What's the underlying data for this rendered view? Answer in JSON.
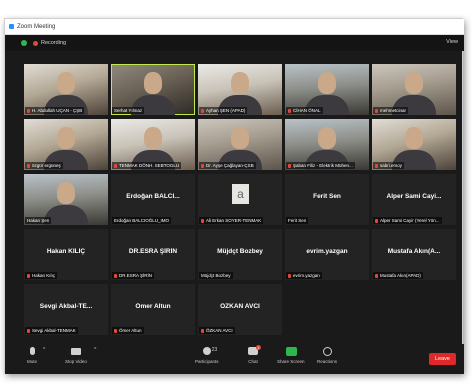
{
  "window": {
    "title": "Zoom Meeting"
  },
  "topbar": {
    "recording_label": "Recording",
    "view_label": "View"
  },
  "tiles": [
    {
      "name": "H. Abdullah UÇAN - ÇŞB",
      "type": "video",
      "variant": "v2",
      "muted": true
    },
    {
      "name": "Serhat Yılmaz",
      "type": "video",
      "variant": "v3",
      "muted": false,
      "active": true
    },
    {
      "name": "Ayhan ŞEN (APAD)",
      "type": "video",
      "variant": "v4",
      "muted": true
    },
    {
      "name": "CİHAN ÖNAL",
      "type": "video",
      "variant": "v5",
      "muted": true
    },
    {
      "name": "mehmetcinar",
      "type": "video",
      "variant": "v1",
      "muted": true
    },
    {
      "name": "özgür ergüneş",
      "type": "video",
      "variant": "v2",
      "muted": true
    },
    {
      "name": "TENMAK DÖNH. SEBTOGLU",
      "type": "video",
      "variant": "v4",
      "muted": true
    },
    {
      "name": "Dr. Ayşe Çağlayan-ÇSB",
      "type": "video",
      "variant": "v1",
      "muted": true
    },
    {
      "name": "Şaban Filiz - Elektrik Mühen...",
      "type": "video",
      "variant": "v5",
      "muted": true
    },
    {
      "name": "sabri.ersoy",
      "type": "video",
      "variant": "v2",
      "muted": true
    },
    {
      "name": "Hakan Şen",
      "type": "video",
      "variant": "v5",
      "muted": false
    },
    {
      "name": "Erdoğan BALCIOĞLU_IMO",
      "label": "Erdoğan BALCI...",
      "type": "name",
      "muted": false
    },
    {
      "name": "Ali Erkan SOYER-TENMAK",
      "label": "a",
      "type": "avatar",
      "muted": true
    },
    {
      "name": "Ferit Sen",
      "label": "Ferit Sen",
      "type": "name",
      "muted": false
    },
    {
      "name": "Alper Sami Cayir (Yerel Yön...",
      "label": "Alper Sami Cayi...",
      "type": "name",
      "muted": true
    },
    {
      "name": "Hakan Kılıç",
      "label": "Hakan KILIÇ",
      "type": "name",
      "muted": true
    },
    {
      "name": "DR.ESRA ŞİRİN",
      "label": "DR.ESRA ŞİRİN",
      "type": "name",
      "muted": true
    },
    {
      "name": "Müjdçt Bozbey",
      "label": "Müjdçt Bozbey",
      "type": "name",
      "muted": false
    },
    {
      "name": "evrim.yazgan",
      "label": "evrim.yazgan",
      "type": "name",
      "muted": true
    },
    {
      "name": "Mustafa Akın(APAD)",
      "label": "Mustafa Akın(A...",
      "type": "name",
      "muted": true
    },
    {
      "name": "Sevgi Akbal-TENMAK",
      "label": "Sevgi Akbal-TE...",
      "type": "name",
      "muted": true
    },
    {
      "name": "Ömer Altun",
      "label": "Ömer Altun",
      "type": "name",
      "muted": true
    },
    {
      "name": "ÖZKAN AVCI",
      "label": "ÖZKAN AVCI",
      "type": "name",
      "muted": true
    }
  ],
  "toolbar": {
    "mute_label": "Mute",
    "video_label": "Stop Video",
    "participants_label": "Participants",
    "participants_count": "23",
    "chat_label": "Chat",
    "chat_badge": "1",
    "share_label": "Share Screen",
    "reactions_label": "Reactions",
    "leave_label": "Leave"
  },
  "colors": {
    "active_speaker": "#c2e94b",
    "leave": "#e02828",
    "share": "#2fb84f",
    "recording": "#e5453a"
  }
}
